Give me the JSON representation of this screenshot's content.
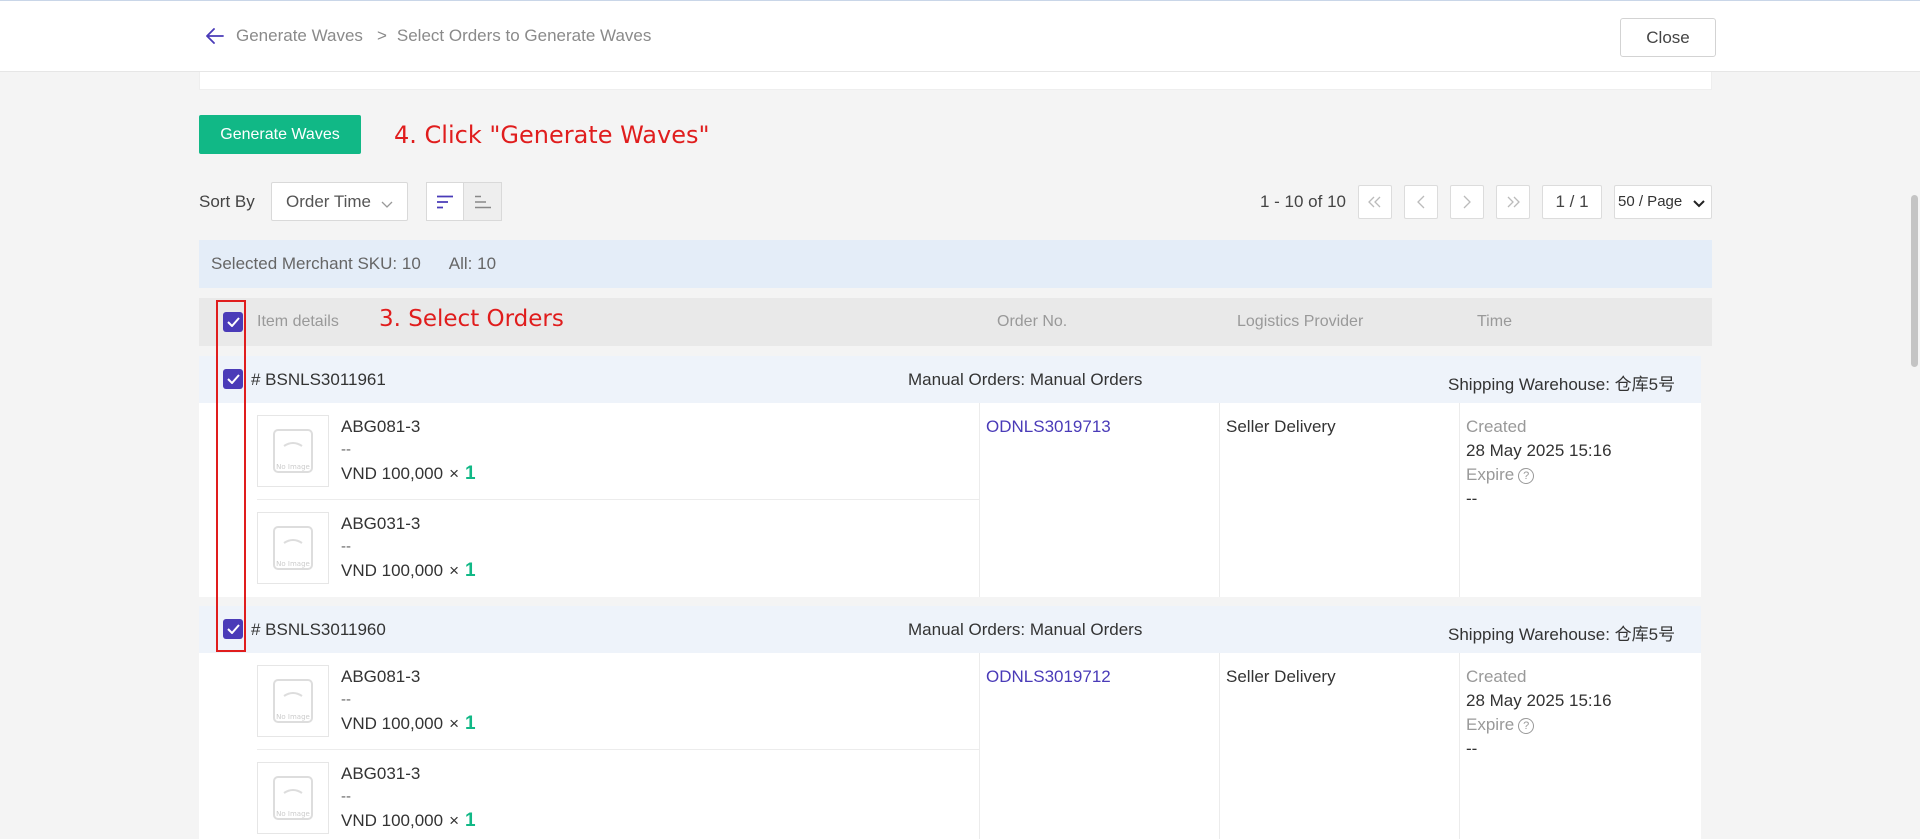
{
  "header": {
    "breadcrumb_parent": "Generate Waves",
    "breadcrumb_separator": ">",
    "breadcrumb_current": "Select Orders to Generate Waves",
    "close_label": "Close"
  },
  "toolbar": {
    "generate_label": "Generate Waves",
    "sort_label": "Sort By",
    "sort_value": "Order Time"
  },
  "annotations": {
    "step4": "4. Click \"Generate Waves\"",
    "step3": "3. Select Orders"
  },
  "pagination": {
    "range": "1 - 10 of 10",
    "page": "1 / 1",
    "page_size": "50 / Page"
  },
  "summary": {
    "selected": "Selected Merchant SKU: 10",
    "all": "All: 10"
  },
  "table": {
    "col_item": "Item details",
    "col_order": "Order No.",
    "col_logistics": "Logistics Provider",
    "col_time": "Time"
  },
  "orders": [
    {
      "number": "# BSNLS3011961",
      "source": "Manual Orders: Manual Orders",
      "warehouse": "Shipping Warehouse: 仓库5号",
      "order_no": "ODNLS3019713",
      "logistics": "Seller Delivery",
      "created_label": "Created",
      "created": "28 May 2025 15:16",
      "expire_label": "Expire",
      "expire": "--",
      "items": [
        {
          "sku": "ABG081-3",
          "variant": "--",
          "price": "VND 100,000",
          "x": "×",
          "qty": "1"
        },
        {
          "sku": "ABG031-3",
          "variant": "--",
          "price": "VND 100,000",
          "x": "×",
          "qty": "1"
        }
      ]
    },
    {
      "number": "# BSNLS3011960",
      "source": "Manual Orders: Manual Orders",
      "warehouse": "Shipping Warehouse: 仓库5号",
      "order_no": "ODNLS3019712",
      "logistics": "Seller Delivery",
      "created_label": "Created",
      "created": "28 May 2025 15:16",
      "expire_label": "Expire",
      "expire": "--",
      "items": [
        {
          "sku": "ABG081-3",
          "variant": "--",
          "price": "VND 100,000",
          "x": "×",
          "qty": "1"
        },
        {
          "sku": "ABG031-3",
          "variant": "--",
          "price": "VND 100,000",
          "x": "×",
          "qty": "1"
        }
      ]
    }
  ],
  "colors": {
    "primary_green": "#11b886",
    "accent_purple": "#4a3bb8",
    "annotation_red": "#e01d1d"
  }
}
